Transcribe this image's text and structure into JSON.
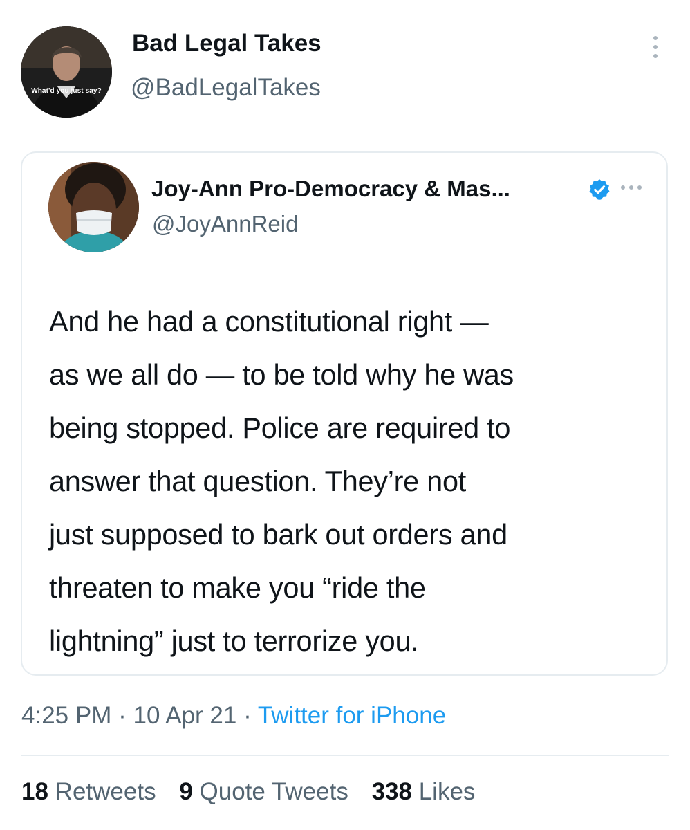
{
  "author": {
    "display_name": "Bad Legal Takes",
    "handle": "@BadLegalTakes",
    "avatar_caption": "What'd you just say?",
    "avatar_icon": "judge-avatar"
  },
  "menu_icon": "more-vertical-icon",
  "quoted_tweet": {
    "display_name": "Joy-Ann Pro-Democracy & Mas...",
    "handle": "@JoyAnnReid",
    "verified_icon": "verified-badge-icon",
    "menu_icon": "more-horizontal-icon",
    "body_lines": [
      "And he had a constitutional right —",
      "as we all do — to be told why he was",
      "being stopped. Police are required to",
      "answer that question. They’re not",
      "just supposed to bark out orders and",
      "threaten to make you “ride the",
      "lightning” just to terrorize you."
    ]
  },
  "meta": {
    "time": "4:25 PM",
    "separator": "·",
    "date": "10 Apr 21",
    "source": "Twitter for iPhone"
  },
  "stats": {
    "retweets_count": "18",
    "retweets_label": "Retweets",
    "quotes_count": "9",
    "quotes_label": "Quote Tweets",
    "likes_count": "338",
    "likes_label": "Likes"
  },
  "colors": {
    "text": "#0f1419",
    "secondary": "#536471",
    "link": "#1d9bf0",
    "border": "#e6ecf0",
    "verified": "#1d9bf0"
  }
}
